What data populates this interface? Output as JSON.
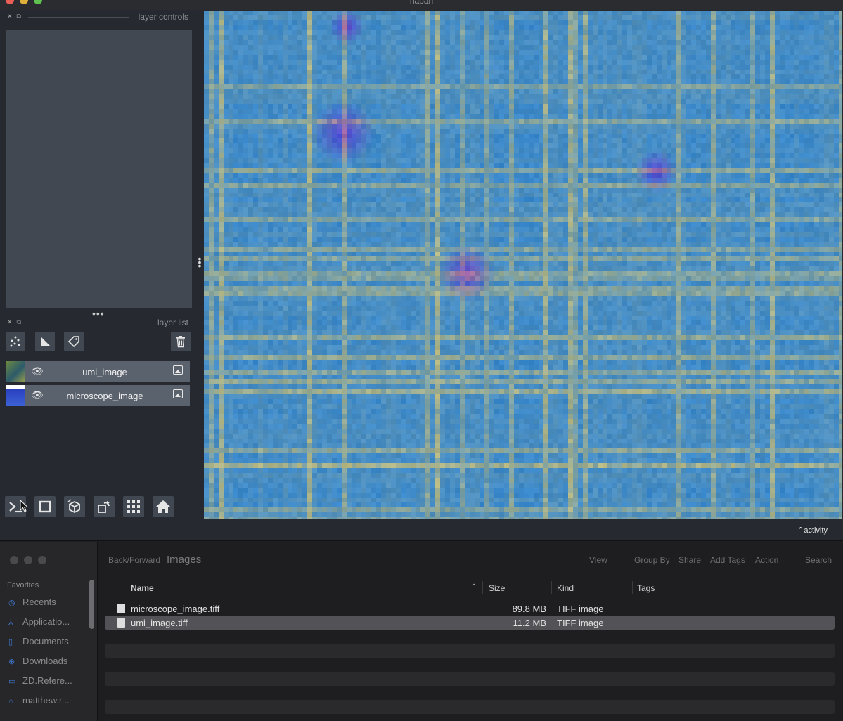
{
  "napari": {
    "title": "napari",
    "layer_controls_label": "layer controls",
    "layer_list_label": "layer list",
    "layers": [
      {
        "name": "umi_image",
        "visible": true,
        "type": "image"
      },
      {
        "name": "microscope_image",
        "visible": true,
        "type": "image"
      }
    ],
    "tools": [
      "points-icon",
      "shapes-icon",
      "labels-icon",
      "trash-icon"
    ],
    "bottom_buttons": [
      "console-icon",
      "square-icon",
      "cube-icon",
      "rotate-icon",
      "grid-icon",
      "home-icon"
    ],
    "activity_label": "activity",
    "colors": {
      "canvas_base": "#3b8ec8",
      "panel": "#414851",
      "background": "#262930"
    }
  },
  "finder": {
    "back_forward_label": "Back/Forward",
    "folder_title": "Images",
    "toolbar": {
      "view": "View",
      "group_by": "Group By",
      "share": "Share",
      "add_tags": "Add Tags",
      "action": "Action",
      "search": "Search"
    },
    "sidebar": {
      "heading": "Favorites",
      "items": [
        {
          "label": "Recents",
          "icon": "clock-icon"
        },
        {
          "label": "Applicatio...",
          "icon": "apps-icon"
        },
        {
          "label": "Documents",
          "icon": "document-icon"
        },
        {
          "label": "Downloads",
          "icon": "download-icon"
        },
        {
          "label": "ZD.Refere...",
          "icon": "folder-icon"
        },
        {
          "label": "matthew.r...",
          "icon": "home-icon"
        }
      ]
    },
    "columns": {
      "name": "Name",
      "size": "Size",
      "kind": "Kind",
      "tags": "Tags"
    },
    "files": [
      {
        "name": "microscope_image.tiff",
        "size": "89.8 MB",
        "kind": "TIFF image",
        "selected": false
      },
      {
        "name": "umi_image.tiff",
        "size": "11.2 MB",
        "kind": "TIFF image",
        "selected": true
      }
    ]
  }
}
